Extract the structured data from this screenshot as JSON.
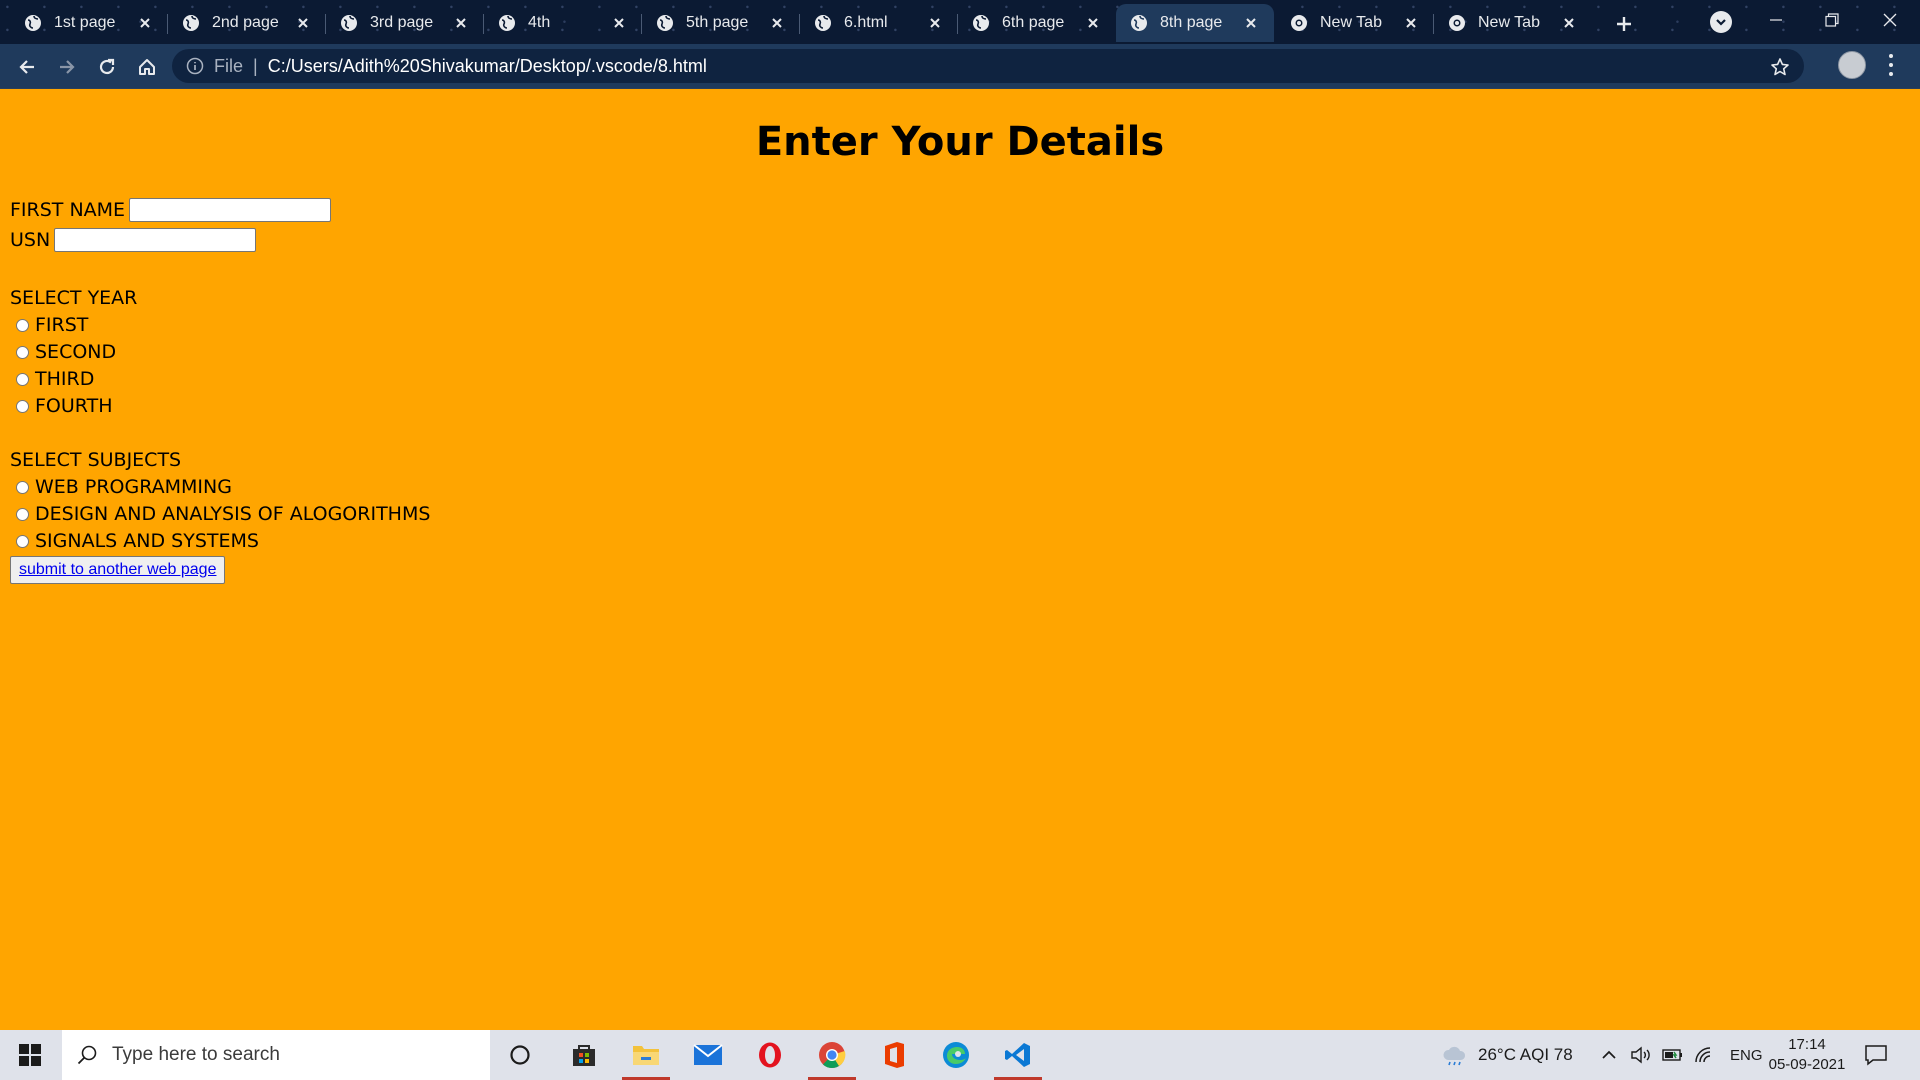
{
  "browser": {
    "tabs": [
      {
        "label": "1st page",
        "active": false
      },
      {
        "label": "2nd page",
        "active": false
      },
      {
        "label": "3rd page",
        "active": false
      },
      {
        "label": "4th",
        "active": false
      },
      {
        "label": "5th page",
        "active": false
      },
      {
        "label": "6.html",
        "active": false
      },
      {
        "label": "6th page",
        "active": false
      },
      {
        "label": "8th page",
        "active": true
      },
      {
        "label": "New Tab",
        "active": false
      },
      {
        "label": "New Tab",
        "active": false
      }
    ],
    "address": {
      "scheme": "File",
      "url": "C:/Users/Adith%20Shivakumar/Desktop/.vscode/8.html"
    }
  },
  "page": {
    "title": "Enter Your Details",
    "first_name_label": "FIRST NAME",
    "usn_label": "USN",
    "year_label": "SELECT YEAR",
    "years": [
      "FIRST",
      "SECOND",
      "THIRD",
      "FOURTH"
    ],
    "subjects_label": "SELECT SUBJECTS",
    "subjects": [
      "WEB PROGRAMMING",
      "DESIGN AND ANALYSIS OF ALOGORITHMS",
      "SIGNALS AND SYSTEMS"
    ],
    "submit_label": "submit to another web page"
  },
  "taskbar": {
    "search_placeholder": "Type here to search",
    "weather": "26°C  AQI 78",
    "language": "ENG",
    "time": "17:14",
    "date": "05-09-2021"
  },
  "colors": {
    "page_background": "#ffa500",
    "browser_frame": "#1f3a5c"
  }
}
